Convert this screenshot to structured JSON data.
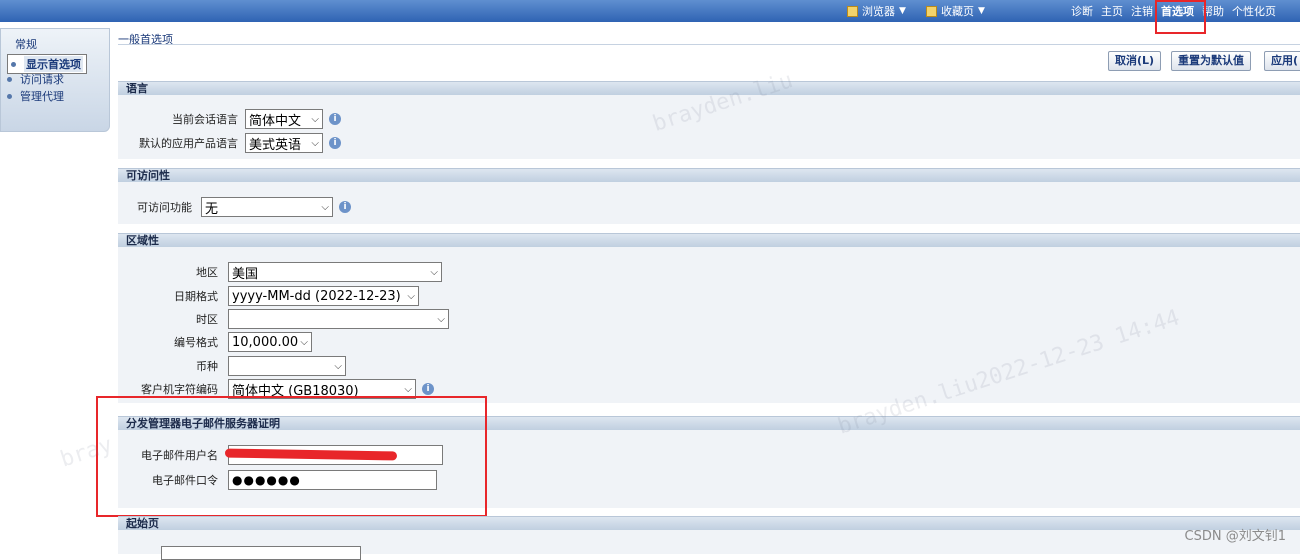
{
  "topbar": {
    "browser_menu": "浏览器",
    "favorites_menu": "收藏页",
    "links": [
      "诊断",
      "主页",
      "注销",
      "首选项",
      "帮助",
      "个性化页"
    ]
  },
  "leftnav": {
    "category": "常规",
    "items": [
      "显示首选项",
      "访问请求",
      "管理代理"
    ]
  },
  "page_title": "一般首选项",
  "buttons": {
    "cancel": "取消(L)",
    "reset": "重置为默认值",
    "apply": "应用("
  },
  "sections": {
    "language": {
      "title": "语言",
      "session_label": "当前会话语言",
      "session_value": "简体中文",
      "default_label": "默认的应用产品语言",
      "default_value": "美式英语"
    },
    "accessibility": {
      "title": "可访问性",
      "feature_label": "可访问功能",
      "feature_value": "无"
    },
    "regional": {
      "title": "区域性",
      "territory_label": "地区",
      "territory_value": "美国",
      "date_label": "日期格式",
      "date_value": "yyyy-MM-dd (2022-12-23)",
      "timezone_label": "时区",
      "timezone_value": "",
      "number_label": "编号格式",
      "number_value": "10,000.00",
      "currency_label": "币种",
      "currency_value": "",
      "charset_label": "客户机字符编码",
      "charset_value": "简体中文 (GB18030)"
    },
    "mail": {
      "title": "分发管理器电子邮件服务器证明",
      "user_label": "电子邮件用户名",
      "user_value": "",
      "password_label": "电子邮件口令",
      "password_value": "●●●●●●"
    },
    "start_page": {
      "title": "起始页"
    }
  },
  "watermark": "CSDN @刘文钊1",
  "colors": {
    "accent": "#2f63b3",
    "highlight": "#e8262a"
  }
}
